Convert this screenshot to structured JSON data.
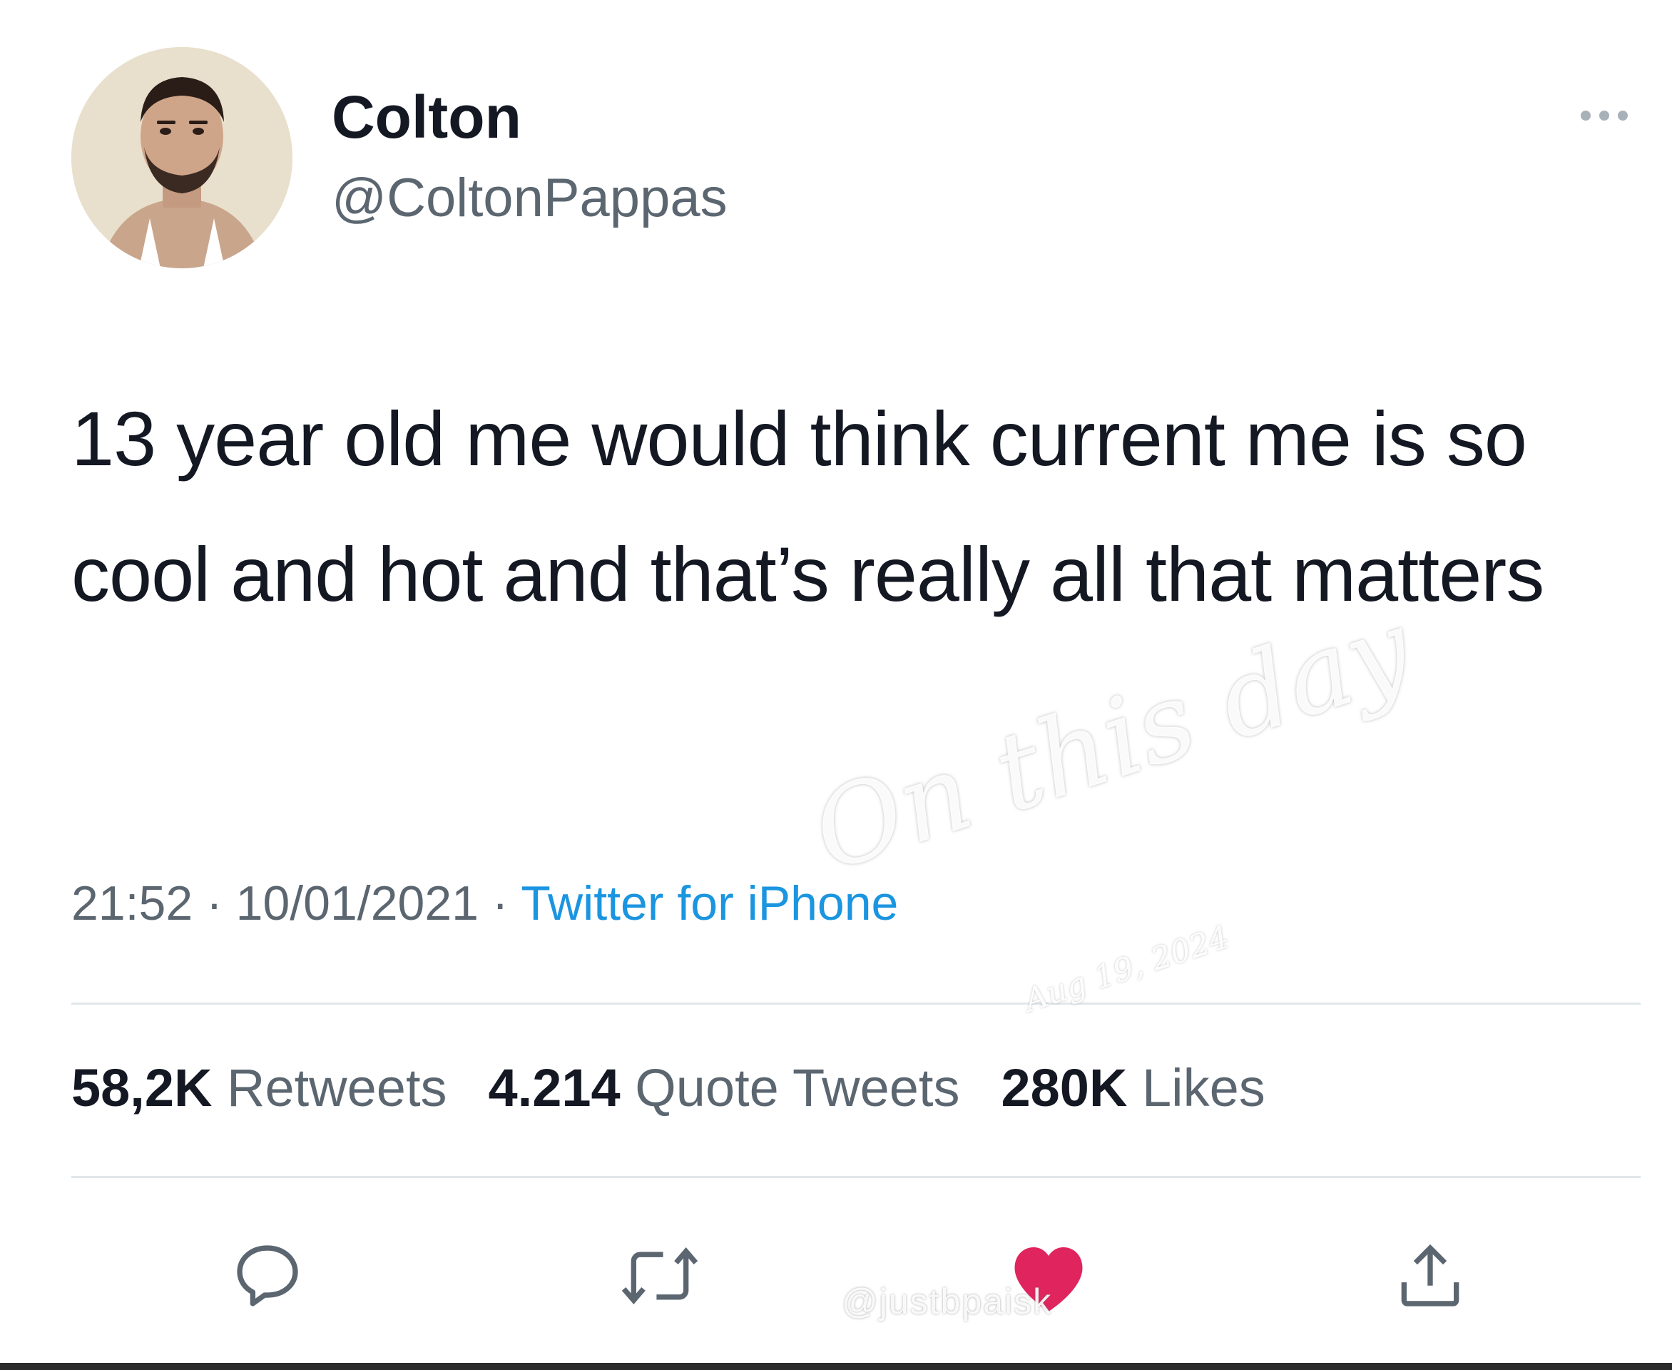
{
  "user": {
    "display_name": "Colton",
    "handle": "@ColtonPappas"
  },
  "tweet": {
    "text": "13 year old me would think current me is so cool and hot and that’s really all that matters",
    "time": "21:52",
    "date": "10/01/2021",
    "separator": "·",
    "source": "Twitter for iPhone"
  },
  "stats": {
    "retweets_count": "58,2K",
    "retweets_label": "Retweets",
    "quotes_count": "4.214",
    "quotes_label": "Quote Tweets",
    "likes_count": "280K",
    "likes_label": "Likes"
  },
  "icons": {
    "more": "more-dots-icon",
    "reply": "reply-icon",
    "retweet": "retweet-icon",
    "like": "heart-icon",
    "share": "share-icon"
  },
  "overlay": {
    "watermark": "On this day",
    "watermark_date": "Aug 19, 2024",
    "app_handle": "@justbpaisk"
  },
  "colors": {
    "text": "#141823",
    "secondary": "#5b6670",
    "link": "#1b95e0",
    "divider": "#e1e6ea",
    "like_active": "#e0245e"
  }
}
